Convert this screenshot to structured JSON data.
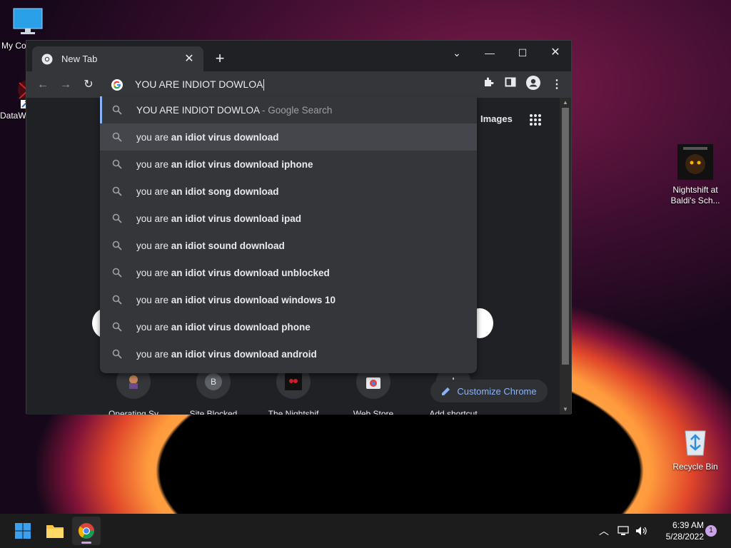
{
  "desktop": {
    "icons": [
      {
        "label": "My Co"
      },
      {
        "label": "DataW"
      },
      {
        "label": "Nightshift at Baldi's Sch..."
      },
      {
        "label": "Recycle Bin"
      }
    ]
  },
  "browser": {
    "tab": {
      "title": "New Tab"
    },
    "omnibox": {
      "text": "YOU ARE INDIOT DOWLOA"
    },
    "new_tab_page": {
      "images_link": "Images",
      "shortcuts": [
        {
          "label": "Operating Sy",
          "initial": ""
        },
        {
          "label": "Site Blocked",
          "initial": "B"
        },
        {
          "label": "The Nightshif",
          "initial": ""
        },
        {
          "label": "Web Store",
          "initial": ""
        },
        {
          "label": "Add shortcut",
          "initial": "+"
        }
      ],
      "customize_label": "Customize Chrome"
    },
    "suggestions": [
      {
        "prefix": "YOU ARE INDIOT DOWLOA",
        "bold": "",
        "suffix": " - Google Search"
      },
      {
        "prefix": "you are ",
        "bold": "an idiot virus download",
        "suffix": ""
      },
      {
        "prefix": "you are ",
        "bold": "an idiot virus download iphone",
        "suffix": ""
      },
      {
        "prefix": "you are ",
        "bold": "an idiot song download",
        "suffix": ""
      },
      {
        "prefix": "you are ",
        "bold": "an idiot virus download ipad",
        "suffix": ""
      },
      {
        "prefix": "you are ",
        "bold": "an idiot sound download",
        "suffix": ""
      },
      {
        "prefix": "you are ",
        "bold": "an idiot virus download unblocked",
        "suffix": ""
      },
      {
        "prefix": "you are ",
        "bold": "an idiot virus download windows 10",
        "suffix": ""
      },
      {
        "prefix": "you are ",
        "bold": "an idiot virus download phone",
        "suffix": ""
      },
      {
        "prefix": "you are ",
        "bold": "an idiot virus download android",
        "suffix": ""
      }
    ]
  },
  "taskbar": {
    "time": "6:39 AM",
    "date": "5/28/2022",
    "notification_count": "1"
  },
  "colors": {
    "accent": "#8ab4f8",
    "window_bg": "#202124",
    "toolbar_bg": "#35363a",
    "taskbar_bg": "#1c1c1c"
  }
}
